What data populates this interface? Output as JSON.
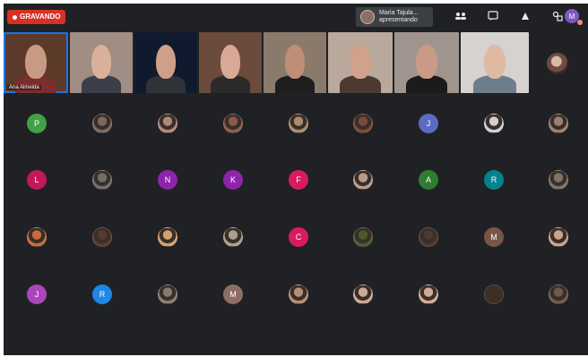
{
  "recording": {
    "label": "GRAVANDO"
  },
  "presenter_chip": {
    "line1": "Maria Tajula...",
    "line2": "apresentando"
  },
  "top_icons": [
    "people-icon",
    "chat-icon",
    "activities-icon",
    "shapes-icon"
  ],
  "self_avatar_initial": "M",
  "video_strip": {
    "tiles": [
      {
        "name": "Ana Almeida",
        "bg": "#5b3a2a",
        "skin": "#c99a83",
        "shirt": "#7a2e2e",
        "active": true
      },
      {
        "name": "",
        "bg": "#a08d83",
        "skin": "#d9b19a",
        "shirt": "#3b3f4a"
      },
      {
        "name": "",
        "bg": "#0f1a2e",
        "skin": "#cfa089",
        "shirt": "#2f3337"
      },
      {
        "name": "",
        "bg": "#6b4b3c",
        "skin": "#d8a994",
        "shirt": "#2a2a2a"
      },
      {
        "name": "",
        "bg": "#8a7a6c",
        "skin": "#c08d76",
        "shirt": "#1e1e1e"
      },
      {
        "name": "",
        "bg": "#b8a99c",
        "skin": "#d1a28b",
        "shirt": "#4a3a32"
      },
      {
        "name": "",
        "bg": "#a0958e",
        "skin": "#c99b86",
        "shirt": "#1b1b1b"
      },
      {
        "name": "",
        "bg": "#d6d2cf",
        "skin": "#e0b9a3",
        "shirt": "#6d7d8c"
      }
    ]
  },
  "participant_grid": {
    "rows": [
      [
        {
          "type": "letter",
          "letter": "P",
          "color": "#43a047"
        },
        {
          "type": "photo",
          "icon": "participant-photo",
          "color": "#7a6a5e"
        },
        {
          "type": "photo",
          "icon": "participant-photo",
          "color": "#b08878"
        },
        {
          "type": "photo",
          "icon": "participant-photo",
          "color": "#8d5a4a"
        },
        {
          "type": "photo",
          "icon": "participant-photo",
          "color": "#a98d70"
        },
        {
          "type": "photo",
          "icon": "participant-photo",
          "color": "#7b4a3a"
        },
        {
          "type": "letter",
          "letter": "J",
          "color": "#5c6bc0"
        },
        {
          "type": "photo",
          "icon": "participant-photo",
          "color": "#d0d0d0"
        },
        {
          "type": "photo",
          "icon": "participant-photo",
          "color": "#9a8072"
        }
      ],
      [
        {
          "type": "letter",
          "letter": "L",
          "color": "#c2185b"
        },
        {
          "type": "photo",
          "icon": "participant-photo",
          "color": "#6e6e6e"
        },
        {
          "type": "letter",
          "letter": "N",
          "color": "#8e24aa"
        },
        {
          "type": "letter",
          "letter": "K",
          "color": "#8e24aa"
        },
        {
          "type": "letter",
          "letter": "F",
          "color": "#d81b60"
        },
        {
          "type": "photo",
          "icon": "participant-photo",
          "color": "#b89a86"
        },
        {
          "type": "letter",
          "letter": "A",
          "color": "#2e7d32"
        },
        {
          "type": "letter",
          "letter": "R",
          "color": "#00838f"
        },
        {
          "type": "photo",
          "icon": "participant-photo",
          "color": "#7d7268"
        }
      ],
      [
        {
          "type": "photo",
          "icon": "participant-photo",
          "color": "#c96a3c"
        },
        {
          "type": "photo",
          "icon": "participant-photo",
          "color": "#5a3a2e"
        },
        {
          "type": "photo",
          "icon": "participant-photo",
          "color": "#d4a070"
        },
        {
          "type": "photo",
          "icon": "participant-photo",
          "color": "#a8a08a"
        },
        {
          "type": "letter",
          "letter": "C",
          "color": "#d81b60"
        },
        {
          "type": "photo",
          "icon": "participant-photo",
          "color": "#4a5a2e"
        },
        {
          "type": "photo",
          "icon": "participant-photo",
          "color": "#4a3a32"
        },
        {
          "type": "letter",
          "letter": "M",
          "color": "#795548"
        },
        {
          "type": "photo",
          "icon": "participant-photo",
          "color": "#c9a28c"
        }
      ],
      [
        {
          "type": "letter",
          "letter": "J",
          "color": "#ab47bc"
        },
        {
          "type": "letter",
          "letter": "R",
          "color": "#1e88e5"
        },
        {
          "type": "photo",
          "icon": "participant-photo",
          "color": "#8a7a6c"
        },
        {
          "type": "letter",
          "letter": "M",
          "color": "#8d6e63"
        },
        {
          "type": "photo",
          "icon": "participant-photo",
          "color": "#b58f74"
        },
        {
          "type": "photo",
          "icon": "participant-photo",
          "color": "#caa892"
        },
        {
          "type": "photo",
          "icon": "participant-photo",
          "color": "#d0aa98"
        },
        {
          "type": "photo",
          "icon": "participant-photo",
          "color": "#3e2e22"
        },
        {
          "type": "photo",
          "icon": "participant-photo",
          "color": "#6d5a4e"
        }
      ]
    ]
  }
}
